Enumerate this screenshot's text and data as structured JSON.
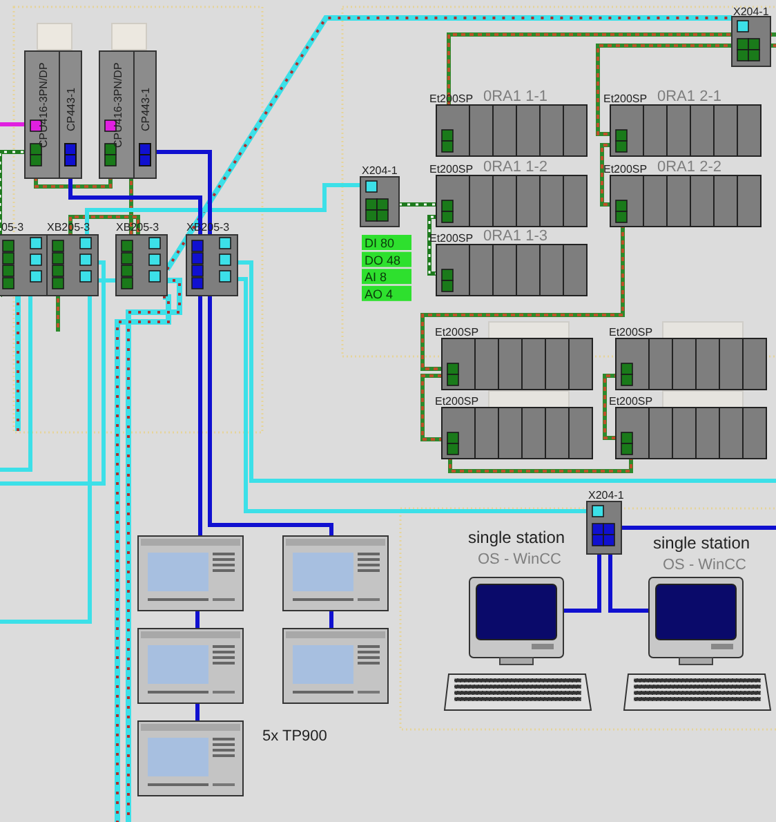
{
  "plcs": [
    {
      "cpu": "CPU416-3PN/DP",
      "cp": "CP443-1"
    },
    {
      "cpu": "CPU416-3PN/DP",
      "cp": "CP443-1"
    }
  ],
  "switches": [
    {
      "label": "05-3"
    },
    {
      "label": "XB205-3"
    },
    {
      "label": "XB205-3"
    },
    {
      "label": "XB205-3"
    }
  ],
  "x204": [
    {
      "label": "X204-1"
    },
    {
      "label": "X204-1"
    },
    {
      "label": "X204-1"
    }
  ],
  "io_badges": [
    "DI 80",
    "DO 48",
    "AI 8",
    "AO 4"
  ],
  "et200": [
    {
      "kind": "named",
      "type": "Et200SP",
      "name": "0RA1 1-1"
    },
    {
      "kind": "named",
      "type": "Et200SP",
      "name": "0RA1 2-1"
    },
    {
      "kind": "named",
      "type": "Et200SP",
      "name": "0RA1 1-2"
    },
    {
      "kind": "named",
      "type": "Et200SP",
      "name": "0RA1 2-2"
    },
    {
      "kind": "named",
      "type": "Et200SP",
      "name": "0RA1 1-3"
    },
    {
      "kind": "tabbed",
      "type": "Et200SP"
    },
    {
      "kind": "tabbed",
      "type": "Et200SP"
    },
    {
      "kind": "tabbed",
      "type": "Et200SP"
    },
    {
      "kind": "tabbed",
      "type": "Et200SP"
    }
  ],
  "hmi_label": "5x TP900",
  "stations": [
    {
      "title": "single station",
      "subtitle": "OS - WinCC"
    },
    {
      "title": "single station",
      "subtitle": "OS - WinCC"
    }
  ]
}
